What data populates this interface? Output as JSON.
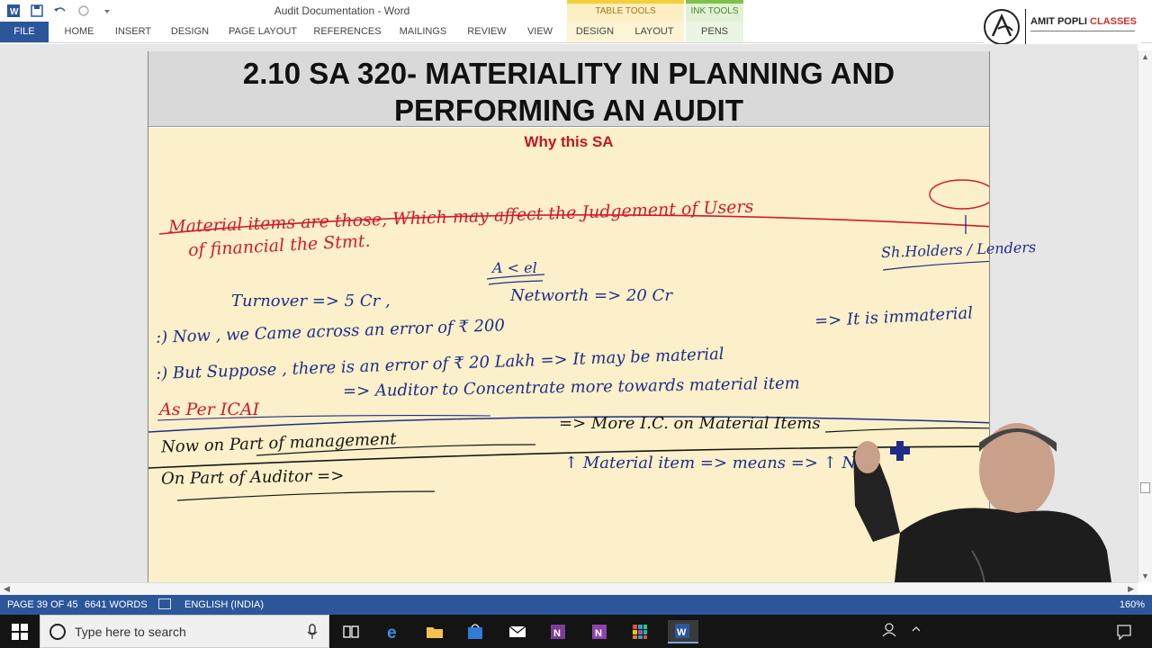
{
  "window": {
    "title": "Audit Documentation - Word",
    "contextual_groups": [
      {
        "label": "TABLE TOOLS",
        "color": "#f5cf3a"
      },
      {
        "label": "INK TOOLS",
        "color": "#7fc24a"
      }
    ]
  },
  "ribbon": {
    "file": "FILE",
    "tabs": [
      "HOME",
      "INSERT",
      "DESIGN",
      "PAGE LAYOUT",
      "REFERENCES",
      "MAILINGS",
      "REVIEW",
      "VIEW",
      "DESIGN",
      "LAYOUT",
      "PENS"
    ],
    "accent": "#2b579a"
  },
  "logo": {
    "name": "AMIT POPLI ",
    "accent_word": "CLASSES"
  },
  "document": {
    "heading_line1": "2.10 SA 320- MATERIALITY IN PLANNING AND",
    "heading_line2": "PERFORMING AN AUDIT",
    "section_title": "Why this SA",
    "ink_notes": [
      {
        "id": "def1",
        "text": "Material items are those, Which may affect the Judgement of Users",
        "color": "red"
      },
      {
        "id": "def2",
        "text": "of financial the Stmt.",
        "color": "red"
      },
      {
        "id": "stake",
        "text": "Sh.Holders / Lenders",
        "color": "blue"
      },
      {
        "id": "abracket",
        "text": "A < el",
        "color": "blue"
      },
      {
        "id": "turnover",
        "text": "Turnover => 5 Cr ,",
        "color": "blue"
      },
      {
        "id": "networth",
        "text": "Networth => 20 Cr",
        "color": "blue"
      },
      {
        "id": "now1",
        "text": ":) Now , we Came across an error of ₹ 200",
        "color": "blue"
      },
      {
        "id": "immaterial",
        "text": "=> It is immaterial",
        "color": "blue"
      },
      {
        "id": "but",
        "text": ":) But Suppose , there is an error of ₹ 20 Lakh => It may be material",
        "color": "blue"
      },
      {
        "id": "icai",
        "text": "As Per ICAI",
        "color": "red"
      },
      {
        "id": "auditor-conc",
        "text": "=> Auditor to Concentrate more towards material item",
        "color": "blue"
      },
      {
        "id": "mgmt",
        "text": "Now on Part of management",
        "color": "black"
      },
      {
        "id": "ic",
        "text": "=> More I.C. on Material Items",
        "color": "black"
      },
      {
        "id": "auditor",
        "text": "On Part of Auditor =>",
        "color": "black"
      },
      {
        "id": "nte",
        "text": "↑ Material item => means => ↑ NTE",
        "color": "blue"
      }
    ]
  },
  "status": {
    "page": "PAGE 39 OF 45",
    "words": "6641 WORDS",
    "language": "ENGLISH (INDIA)",
    "zoom": "160%"
  },
  "taskbar": {
    "search_placeholder": "Type here to search"
  }
}
